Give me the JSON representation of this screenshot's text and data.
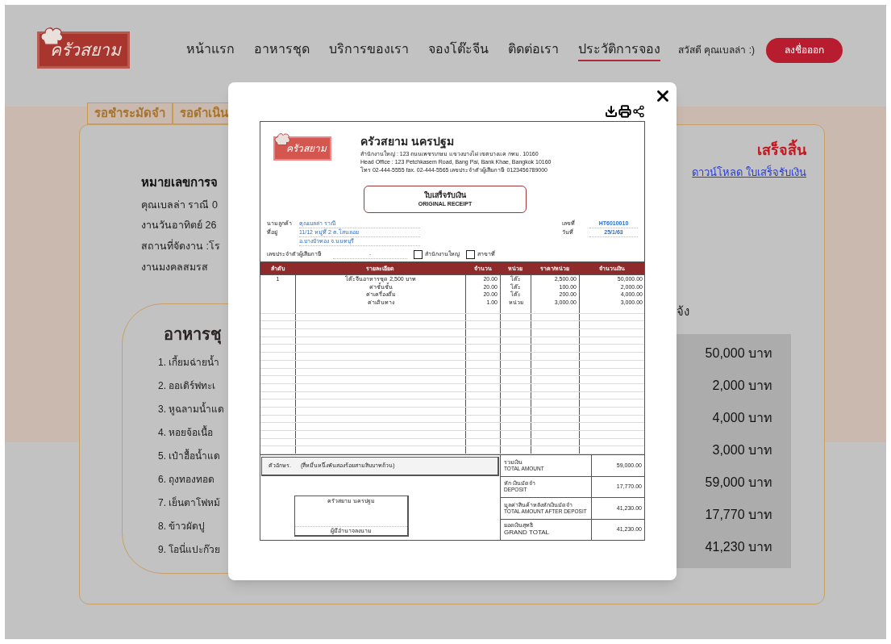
{
  "header": {
    "logo_text": "ครัวสยาม",
    "nav": [
      {
        "label": "หน้าแรก",
        "selected": false
      },
      {
        "label": "อาหารชุด",
        "selected": false
      },
      {
        "label": "บริการของเรา",
        "selected": false
      },
      {
        "label": "จองโต๊ะจีน",
        "selected": false
      },
      {
        "label": "ติดต่อเรา",
        "selected": false
      },
      {
        "label": "ประวัติการจอง",
        "selected": true
      }
    ],
    "greeting": "สวัสดี คุณเบลล่า :)",
    "logout": "ลงชื่อออก"
  },
  "tabs": [
    {
      "label": "รอชำระมัดจำ",
      "selected": false
    },
    {
      "label": "รอดำเนิน",
      "selected": false
    }
  ],
  "booking": {
    "title": "หมายเลขการจ",
    "lines": [
      "คุณเบลล่า ราณี 0",
      "งานวันอาทิตย์ 26",
      "สถานที่จัดงาน :โร",
      "งานมงคลสมรส"
    ],
    "status": "เสร็จสิ้น",
    "download_link": "ดาวน์โหลด ใบเสร็จรับเงิน",
    "note": "จ้ง",
    "menu_title": "อาหารชุ",
    "menu_items": [
      "1. เกี้ยมฉ่ายน้ำ",
      "2. ออเดิร์ฟทะเ",
      "3. หูฉลามน้ำแด",
      "4. หอยจ้อเนื้อ",
      "5. เป๋าฮื้อน้ำแด",
      "6. ถุงทองทอด",
      "7. เย็นตาโฟหม้",
      "8. ข้าวผัดปู",
      "9. โอนี่แปะก๊วย"
    ],
    "prices": [
      "50,000 บาท",
      "2,000 บาท",
      "4,000 บาท",
      "3,000 บาท",
      "59,000 บาท",
      "17,770 บาท",
      "41,230 บาท"
    ]
  },
  "receipt": {
    "logo_text": "ครัวสยาม",
    "company": "ครัวสยาม นครปฐม",
    "address_lines": [
      "สำนักงานใหญ่ : 123 ถนนเพชรเกษม แขวงบางไผ่ เขตบางแค กทม. 10160",
      "Head Office : 123 Petchkasem Road, Bang Pai, Bank Khae, Bangkok 10160",
      "โทร 02-444-5555  fax. 02-444-5565  เลขประจำตัวผู้เสียภาษี 0123456789000"
    ],
    "title": "ใบเสร็จรับเงิน",
    "subtitle": "ORIGINAL RECEIPT",
    "customer_label": "นามลูกค้า",
    "customer": "คุณเบลล่า ราณี",
    "address_label": "ที่อยู่",
    "address": [
      "11/12 หมู่ที่ 2 ต.โสนลอย",
      "อ.บางบัวทอง จ.นนทบุรี"
    ],
    "number_label": "เลขที่",
    "number": "HT6010010",
    "date_label": "วันที่",
    "date": "25/1/63",
    "tax_label": "เลขประจำตัวผู้เสียภาษี",
    "tax": "-",
    "checkboxes": [
      {
        "label": "สำนักงานใหญ่",
        "checked": false
      },
      {
        "label": "สาขาที่",
        "checked": false
      }
    ],
    "columns": [
      "ลำดับ",
      "รายละเอียด",
      "จำนวน",
      "หน่วย",
      "ราคา/หน่วย",
      "จำนวนเงิน"
    ],
    "rows": [
      [
        "1",
        "โต๊ะจีนอาหารชุด 2,500 บาท",
        "20.00",
        "โต๊ะ",
        "2,500.00",
        "50,000.00"
      ],
      [
        "",
        "ค่าชั้นชั้น",
        "20.00",
        "โต๊ะ",
        "100.00",
        "2,000.00"
      ],
      [
        "",
        "ค่าเครื่องดื่ม",
        "20.00",
        "โต๊ะ",
        "200.00",
        "4,000.00"
      ],
      [
        "",
        "ค่าเดินทาง",
        "1.00",
        "หน่วย",
        "3,000.00",
        "3,000.00"
      ]
    ],
    "words_label": "ตัวอักษร.",
    "words": "(สี่หมื่นหนึ่งพันสองร้อยสามสิบบาทถ้วน)",
    "signature_company": "ครัวสยาม นครปฐม",
    "signature_label": "ผู้มีอำนาจลงนาม",
    "totals": [
      {
        "label": "รวมเงิน",
        "sub": "TOTAL AMOUNT",
        "value": "59,000.00"
      },
      {
        "label": "หัก เงินมัดจำ",
        "sub": "DEPOSIT",
        "value": "17,770.00"
      },
      {
        "label": "มูลค่าสินค้าหลังหักเงินมัดจำ",
        "sub": "TOTAL AMOUNT AFTER DEPOSIT",
        "value": "41,230.00"
      },
      {
        "label": "ยอดเงินสุทธิ",
        "sub": "GRAND TOTAL",
        "value": "41,230.00"
      }
    ]
  }
}
